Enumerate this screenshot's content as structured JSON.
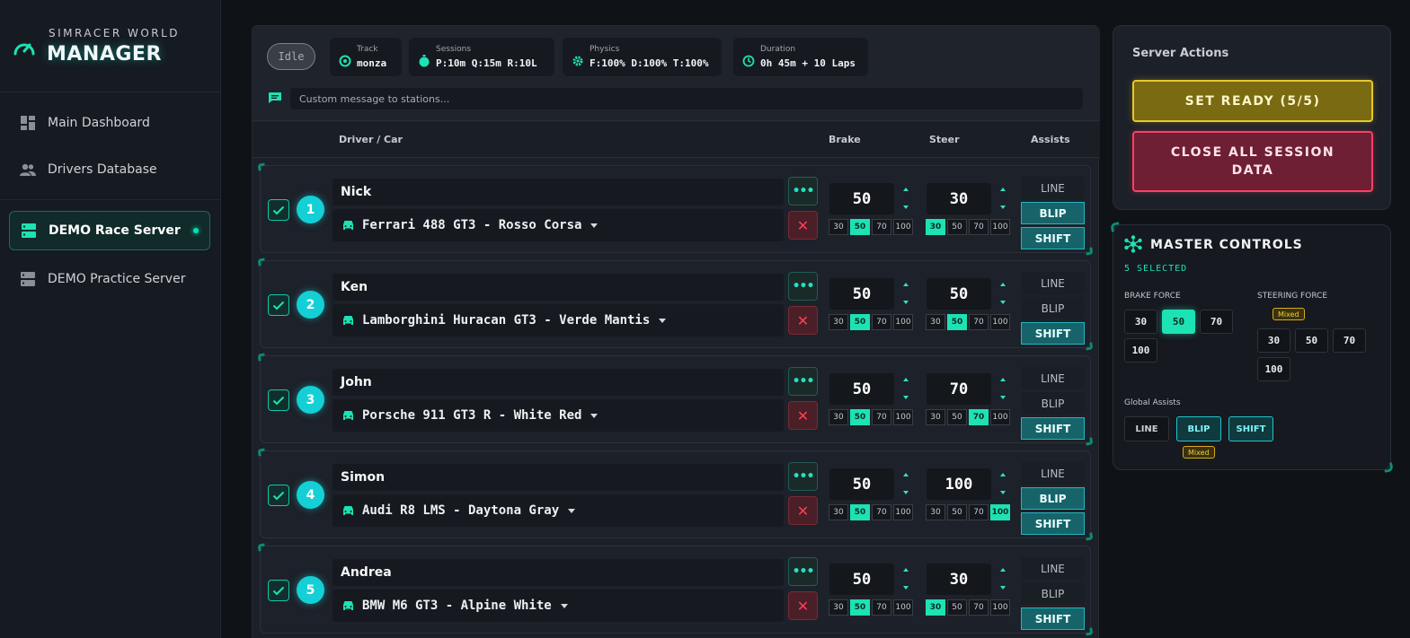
{
  "brand": {
    "top": "SIMRACER WORLD",
    "main": "MANAGER"
  },
  "nav": {
    "items": [
      {
        "label": "Main Dashboard",
        "icon": "dashboard-icon"
      },
      {
        "label": "Drivers Database",
        "icon": "users-icon"
      },
      {
        "label": "DEMO Race Server",
        "icon": "server-icon",
        "active": true
      },
      {
        "label": "DEMO Practice Server",
        "icon": "server-icon"
      }
    ]
  },
  "topbar": {
    "status": "Idle",
    "track": {
      "label": "Track",
      "value": "monza"
    },
    "sessions": {
      "label": "Sessions",
      "value": "P:10m Q:15m R:10L"
    },
    "physics": {
      "label": "Physics",
      "value": "F:100% D:100% T:100%"
    },
    "duration": {
      "label": "Duration",
      "value": "0h 45m + 10 Laps"
    },
    "message_placeholder": "Custom message to stations..."
  },
  "table": {
    "headers": {
      "driver": "Driver / Car",
      "brake": "Brake",
      "steer": "Steer",
      "assists": "Assists"
    },
    "presets": [
      "30",
      "50",
      "70",
      "100"
    ],
    "assist_labels": [
      "LINE",
      "BLIP",
      "SHIFT"
    ],
    "more_label": "•••",
    "delete_label": "✕",
    "rows": [
      {
        "num": "1",
        "driver": "Nick",
        "car": "Ferrari 488 GT3 - Rosso Corsa",
        "brake": "50",
        "steer": "30",
        "assists": [
          false,
          true,
          true
        ]
      },
      {
        "num": "2",
        "driver": "Ken",
        "car": "Lamborghini Huracan GT3 - Verde Mantis",
        "brake": "50",
        "steer": "50",
        "assists": [
          false,
          false,
          true
        ]
      },
      {
        "num": "3",
        "driver": "John",
        "car": "Porsche 911 GT3 R - White Red",
        "brake": "50",
        "steer": "70",
        "assists": [
          false,
          false,
          true
        ]
      },
      {
        "num": "4",
        "driver": "Simon",
        "car": "Audi R8 LMS - Daytona Gray",
        "brake": "50",
        "steer": "100",
        "assists": [
          false,
          true,
          true
        ]
      },
      {
        "num": "5",
        "driver": "Andrea",
        "car": "BMW M6 GT3 - Alpine White",
        "brake": "50",
        "steer": "30",
        "assists": [
          false,
          false,
          true
        ]
      }
    ]
  },
  "actions": {
    "title": "Server Actions",
    "ready_label": "SET READY (5/5)",
    "close_label": "CLOSE ALL SESSION DATA"
  },
  "master": {
    "title": "MASTER CONTROLS",
    "selected": "5 SELECTED",
    "brake_label": "BRAKE FORCE",
    "steer_label": "STEERING FORCE",
    "mixed_label": "Mixed",
    "global_label": "Global Assists",
    "brake_active": "50",
    "global_assists": {
      "LINE": false,
      "BLIP": true,
      "SHIFT": true
    }
  },
  "colors": {
    "accent": "#1de2b3",
    "cyan": "#14cfd6",
    "ready": "#e7c82a",
    "danger": "#ff3f64"
  }
}
